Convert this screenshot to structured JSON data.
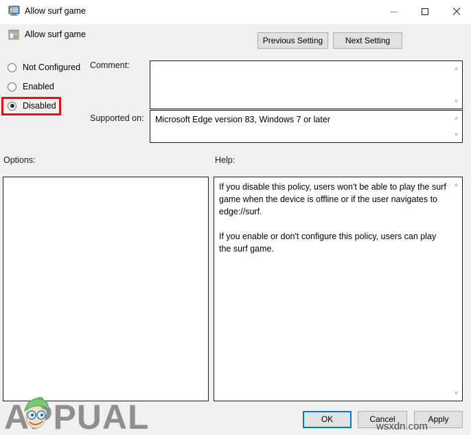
{
  "window": {
    "title": "Allow surf game",
    "icon": "policy-monitor-icon",
    "controls": {
      "minimize": "minimize-icon",
      "maximize": "maximize-icon",
      "close": "close-icon"
    }
  },
  "header": {
    "title": "Allow surf game",
    "icon": "policy-setting-icon"
  },
  "nav_buttons": {
    "previous": "Previous Setting",
    "next": "Next Setting"
  },
  "state_options": [
    {
      "label": "Not Configured",
      "selected": false
    },
    {
      "label": "Enabled",
      "selected": false
    },
    {
      "label": "Disabled",
      "selected": true
    }
  ],
  "fields": {
    "comment_label": "Comment:",
    "comment_value": "",
    "supported_on_label": "Supported on:",
    "supported_on_value": "Microsoft Edge version 83, Windows 7 or later"
  },
  "panels": {
    "options_label": "Options:",
    "options_content": "",
    "help_label": "Help:",
    "help_content": "If you disable this policy, users won't be able to play the surf game when the device is offline or if the user navigates to edge://surf.\n\nIf you enable or don't configure this policy, users can play the surf game."
  },
  "action_buttons": {
    "ok": "OK",
    "cancel": "Cancel",
    "apply": "Apply"
  },
  "annotation": {
    "highlight_color": "#e21212",
    "highlight_target": "Disabled"
  },
  "watermarks": {
    "brand": "APPUALS",
    "site": "wsxdn.com"
  },
  "colors": {
    "window_background": "#f0f0f0",
    "titlebar_background": "#ffffff",
    "button_face": "#e1e1e1",
    "focus_border": "#0078d7",
    "field_background": "#ffffff"
  }
}
